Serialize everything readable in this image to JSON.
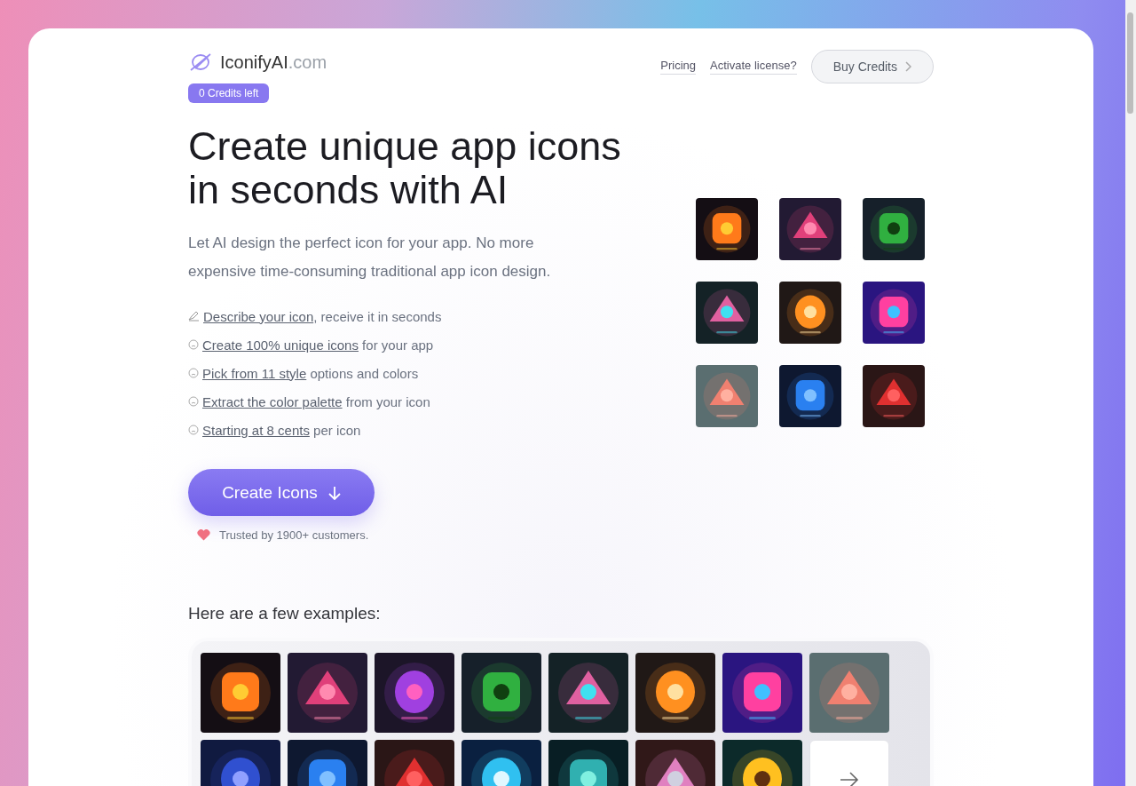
{
  "header": {
    "logo": {
      "name": "IconifyAI",
      "suffix": ".com"
    },
    "credits_badge": "0 Credits left",
    "nav": [
      "Pricing",
      "Activate license?"
    ],
    "buy_button": "Buy Credits"
  },
  "hero": {
    "title": "Create unique app icons in seconds with AI",
    "subtitle": "Let AI design the perfect icon for your app. No more expensive time-consuming traditional app icon design.",
    "features": [
      {
        "kind": "pen",
        "link": "Describe your icon",
        "text": ", receive it in seconds"
      },
      {
        "kind": "smiley",
        "link": "Create 100% unique icons",
        "text": " for your app"
      },
      {
        "kind": "smiley",
        "link": "Pick from 11 style",
        "text": " options and colors"
      },
      {
        "kind": "smiley",
        "link": "Extract the color palette",
        "text": " from your icon"
      },
      {
        "kind": "smiley",
        "link": "Starting at 8 cents",
        "text": " per icon"
      }
    ],
    "cta": "Create Icons",
    "trust": "Trusted by 1900+ customers.",
    "icons": [
      {
        "kind": "picture"
      },
      {
        "kind": "picture"
      },
      {
        "kind": "picture"
      },
      {
        "kind": "picture"
      },
      {
        "kind": "picture"
      },
      {
        "kind": "picture"
      },
      {
        "kind": "picture"
      },
      {
        "kind": "picture"
      },
      {
        "kind": "picture"
      }
    ]
  },
  "examples": {
    "heading": "Here are a few examples:",
    "items": [
      {
        "kind": "picture"
      },
      {
        "kind": "picture"
      },
      {
        "kind": "picture"
      },
      {
        "kind": "picture"
      },
      {
        "kind": "picture"
      },
      {
        "kind": "picture"
      },
      {
        "kind": "picture"
      },
      {
        "kind": "picture"
      },
      {
        "kind": "picture"
      },
      {
        "kind": "picture"
      },
      {
        "kind": "picture"
      },
      {
        "kind": "picture"
      },
      {
        "kind": "picture"
      },
      {
        "kind": "picture"
      },
      {
        "kind": "picture"
      },
      {
        "kind": "more"
      }
    ]
  }
}
